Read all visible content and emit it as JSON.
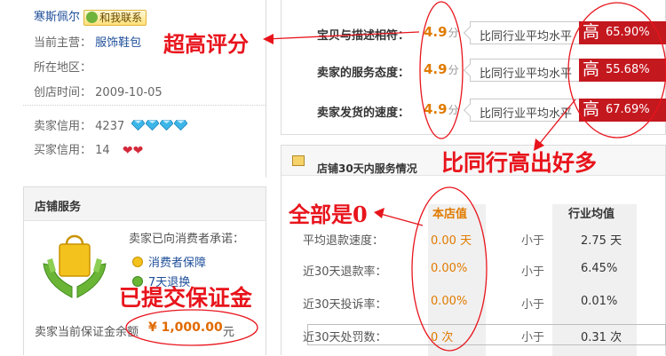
{
  "seller": {
    "name": "寒斯佩尔",
    "contact_label": "和我联系",
    "category_label": "当前主营：",
    "category_value": "服饰鞋包",
    "region_label": "所在地区：",
    "region_value": "",
    "created_label": "创店时间：",
    "created_value": "2009-10-05",
    "seller_credit_label": "卖家信用：",
    "seller_credit_value": "4237",
    "buyer_credit_label": "买家信用：",
    "buyer_credit_value": "14"
  },
  "service": {
    "title": "店铺服务",
    "promise_label": "卖家已向消费者承诺：",
    "items": [
      "消费者保障",
      "7天退换"
    ],
    "deposit_label": "卖家当前保证金余额",
    "deposit_value": "¥ 1,000.00",
    "deposit_unit": "元"
  },
  "ratings": [
    {
      "label": "宝贝与描述相符：",
      "score": "4.9",
      "unit": "分",
      "compare": "比同行业平均水平",
      "level": "高",
      "percent": "65.90%"
    },
    {
      "label": "卖家的服务态度：",
      "score": "4.9",
      "unit": "分",
      "compare": "比同行业平均水平",
      "level": "高",
      "percent": "55.68%"
    },
    {
      "label": "卖家发货的速度：",
      "score": "4.9",
      "unit": "分",
      "compare": "比同行业平均水平",
      "level": "高",
      "percent": "67.69%"
    }
  ],
  "service_stats": {
    "title": "店铺30天内服务情况",
    "col_mine": "本店值",
    "col_avg": "行业均值",
    "rows": [
      {
        "label": "平均退款速度：",
        "mine": "0.00 天",
        "cmp": "小于",
        "avg": "2.75 天"
      },
      {
        "label": "近30天退款率：",
        "mine": "0.00%",
        "cmp": "小于",
        "avg": "6.45%"
      },
      {
        "label": "近30天投诉率：",
        "mine": "0.00%",
        "cmp": "小于",
        "avg": "0.01%"
      },
      {
        "label": "近30天处罚数：",
        "mine": "0 次",
        "cmp": "小于",
        "avg": "0.31 次"
      }
    ]
  },
  "annotations": {
    "high_score": "超高评分",
    "higher_than_peers": "比同行高出好多",
    "all_zero": "全部是0",
    "deposit_paid": "已提交保证金"
  },
  "colors": {
    "annotation_red": "#e8141c",
    "badge_red": "#c4181f",
    "score_orange": "#e07b00",
    "link_blue": "#1f4f9a"
  }
}
